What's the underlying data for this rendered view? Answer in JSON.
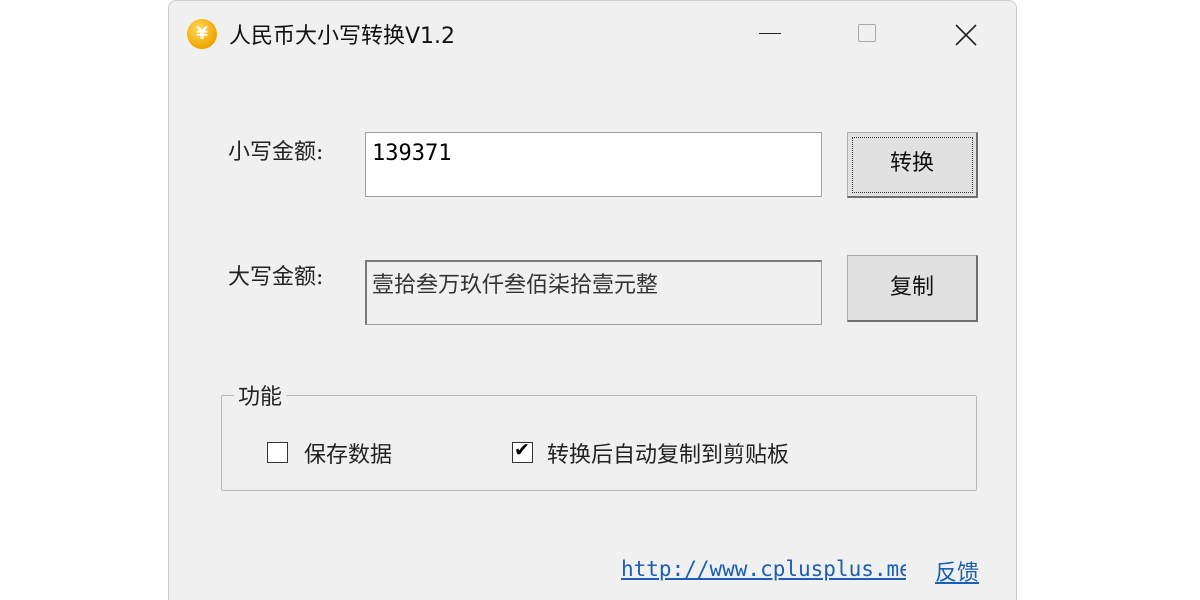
{
  "window": {
    "title": "人民币大小写转换V1.2",
    "icon_symbol": "¥",
    "icon_color": "#f0a500"
  },
  "form": {
    "small_label": "小写金额:",
    "small_value": "139371",
    "big_label": "大写金额:",
    "big_value": "壹拾叁万玖仟叁佰柒拾壹元整",
    "convert_button": "转换",
    "copy_button": "复制"
  },
  "options": {
    "group_title": "功能",
    "save_data": {
      "label": "保存数据",
      "checked": false
    },
    "auto_copy": {
      "label": "转换后自动复制到剪贴板",
      "checked": true
    }
  },
  "footer": {
    "url": "http://www.cplusplus.me",
    "feedback": "反馈",
    "link_color": "#1a5fb4"
  }
}
